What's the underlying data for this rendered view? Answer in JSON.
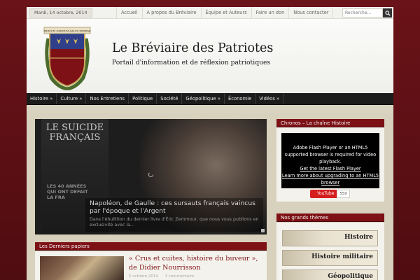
{
  "topbar": {
    "date": "Mardi, 14 octobre, 2014",
    "links": [
      "Accueil",
      "A propos du Bréviaire",
      "Équipe et Auteurs",
      "Faire un don",
      "Nous contacter"
    ],
    "search_placeholder": "Recherche..."
  },
  "header": {
    "title": "Le Bréviaire des Patriotes",
    "tagline": "Portail d'information et de réflexion patriotiques",
    "logo_banner_text": "PRIMUM OMNIUM SALUS PATRIAE"
  },
  "mainnav": {
    "items": [
      "Histoire »",
      "Culture »",
      "Nos Entretiens",
      "Politique",
      "Société",
      "Géopolitique »",
      "Économie",
      "Vidéos »"
    ]
  },
  "slider": {
    "book_title": "LE SUICIDE FRANÇAIS",
    "book_subtitle": "LES 40 ANNÉES QUI ONT DEFAIT LA FRA",
    "headline": "Napoléon, de Gaulle : ces sursauts français vaincus par l'époque et l'Argent",
    "excerpt": "Dans l'ébullition du dernier livre d'Éric Zemmour, que nous vous publions en exclusivité avec la..."
  },
  "latest": {
    "section_title": "Les Derniers papiers",
    "article_title": "« Crus et cuites, histoire du buveur », de Didier Nourrisson",
    "date": "5 octobre 2014",
    "comments": "1 commentaire"
  },
  "sidebar": {
    "video_section_title": "Chronos – La chaîne Histoire",
    "flash_message": "Adobe Flash Player or an HTML5 supported browser is required for video playback.",
    "flash_link1": "Get the latest Flash Player",
    "flash_link2": "Learn more about upgrading to an HTML5 browser",
    "youtube_label": "YouTube",
    "youtube_count": "550",
    "themes_section_title": "Nos grands thèmes",
    "themes": [
      "Histoire",
      "Histoire militaire",
      "Géopolitique"
    ]
  },
  "colors": {
    "brand_red": "#7d1116",
    "page_bg": "#5e0f14",
    "nav_bg": "#1c1c1c"
  }
}
